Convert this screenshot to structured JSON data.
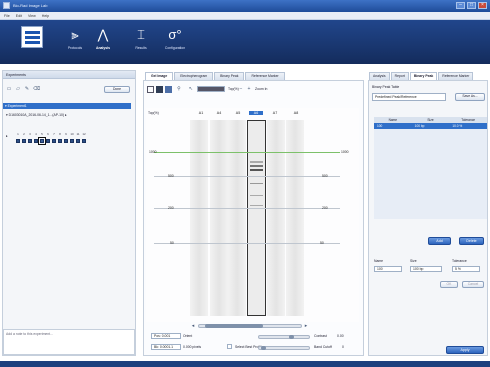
{
  "window": {
    "title": "Bio-Rad Image Lab",
    "controls": [
      "–",
      "□",
      "×"
    ]
  },
  "menu": [
    "File",
    "Edit",
    "View",
    "Help"
  ],
  "toolbar": {
    "tools": [
      {
        "label": "Protocols",
        "icon": "protocol-icon",
        "active": false
      },
      {
        "label": "Analysis",
        "icon": "analysis-icon",
        "active": true
      },
      {
        "label": "Results",
        "icon": "results-icon",
        "active": false
      },
      {
        "label": "Configuration",
        "icon": "configuration-icon",
        "active": false
      }
    ]
  },
  "left_panel": {
    "header": "Experiments",
    "open_button": "Done",
    "tree": [
      {
        "label": "▾ Experiment1"
      },
      {
        "label": "▾ D1603010A_2016-06-14_1...(AP-10)   ▸"
      }
    ],
    "well_numbers": [
      "1",
      "2",
      "3",
      "4",
      "5",
      "6",
      "7",
      "8",
      "9",
      "10",
      "11",
      "12"
    ],
    "selected_well_index": 4,
    "notes_label": "Add a note to this experiment..."
  },
  "center": {
    "tabs": [
      "Gel Image",
      "Electropherogram",
      "Binary Peak",
      "Reference Marker"
    ],
    "active_tab": 0,
    "size_label": "Top(%)",
    "zoom_label": "Zoom In",
    "lanes": [
      "A1",
      "A4",
      "A5",
      "A6",
      "A7",
      "A8"
    ],
    "selected_lane": "A6",
    "ladder_left": [
      "1000",
      "500",
      "200",
      "50"
    ],
    "ladder_right": [
      "1000",
      "500",
      "200",
      "50"
    ],
    "bottom": {
      "row1_value": "Pos: 0.001",
      "row1_unit": "Orient",
      "row2_value": "Bk: 0.0001.1",
      "row2_unit": "0.000 pixels",
      "checkbox_label": "Select Best Profiling",
      "contrast_label": "Contrast",
      "contrast_value": "0.00",
      "band_label": "Band Cutoff",
      "band_value": "0"
    }
  },
  "right_panel": {
    "tabs": [
      "Analysis",
      "Report",
      "Binary Peak",
      "Reference Marker"
    ],
    "active_tab": 2,
    "table_label": "Binary Peak Table",
    "dropdown_value": "Predefined Peak/Reference",
    "dropdown_button": "Save As...",
    "columns": [
      "Name",
      "Size",
      "Tolerance"
    ],
    "rows": [
      {
        "name": "100",
        "size": "100 bp",
        "tolerance": "10.0 %"
      }
    ],
    "add_button": "Add",
    "delete_button": "Delete",
    "edit": {
      "name_label": "Name",
      "name_value": "100",
      "size_label": "Size",
      "size_value": "100 bp",
      "tol_label": "Tolerance",
      "tol_value": "5 %",
      "ok_button": "OK",
      "cancel_button": "Cancel"
    },
    "apply_button": "Apply"
  },
  "colors": {
    "toolbar": "#142c5c",
    "accent": "#2f6fc9",
    "green_line": "#7dc16a"
  }
}
